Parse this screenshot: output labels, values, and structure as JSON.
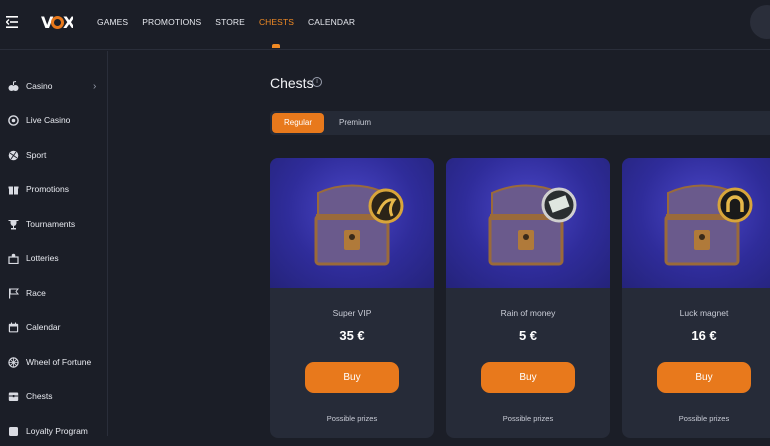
{
  "header": {
    "logo": "VOX",
    "nav": [
      "GAMES",
      "PROMOTIONS",
      "STORE",
      "CHESTS",
      "CALENDAR"
    ],
    "active_nav": "CHESTS"
  },
  "sidebar": {
    "items": [
      {
        "label": "Casino",
        "icon": "slots-icon",
        "has_chevron": true
      },
      {
        "label": "Live Casino",
        "icon": "live-casino-icon"
      },
      {
        "label": "Sport",
        "icon": "sport-ball-icon"
      },
      {
        "label": "Promotions",
        "icon": "gift-icon"
      },
      {
        "label": "Tournaments",
        "icon": "trophy-icon"
      },
      {
        "label": "Lotteries",
        "icon": "lottery-icon"
      },
      {
        "label": "Race",
        "icon": "race-flag-icon"
      },
      {
        "label": "Calendar",
        "icon": "calendar-icon"
      },
      {
        "label": "Wheel of Fortune",
        "icon": "wheel-icon"
      },
      {
        "label": "Chests",
        "icon": "chest-icon"
      },
      {
        "label": "Loyalty Program",
        "icon": "loyalty-icon"
      }
    ]
  },
  "main": {
    "title": "Chests",
    "tabs": [
      {
        "label": "Regular",
        "active": true
      },
      {
        "label": "Premium",
        "active": false
      }
    ],
    "cards": [
      {
        "name": "Super VIP",
        "price": "35 €",
        "buy_label": "Buy",
        "prizes_label": "Possible prizes",
        "coin_icon": "gold-snake-coin-icon"
      },
      {
        "name": "Rain of money",
        "price": "5 €",
        "buy_label": "Buy",
        "prizes_label": "Possible prizes",
        "coin_icon": "money-coin-icon"
      },
      {
        "name": "Luck magnet",
        "price": "16 €",
        "buy_label": "Buy",
        "prizes_label": "Possible prizes",
        "coin_icon": "horseshoe-coin-icon"
      }
    ]
  },
  "colors": {
    "accent": "#e8791c",
    "background": "#1b1e27",
    "card": "#262b38",
    "card_art": "#3a36b0"
  }
}
